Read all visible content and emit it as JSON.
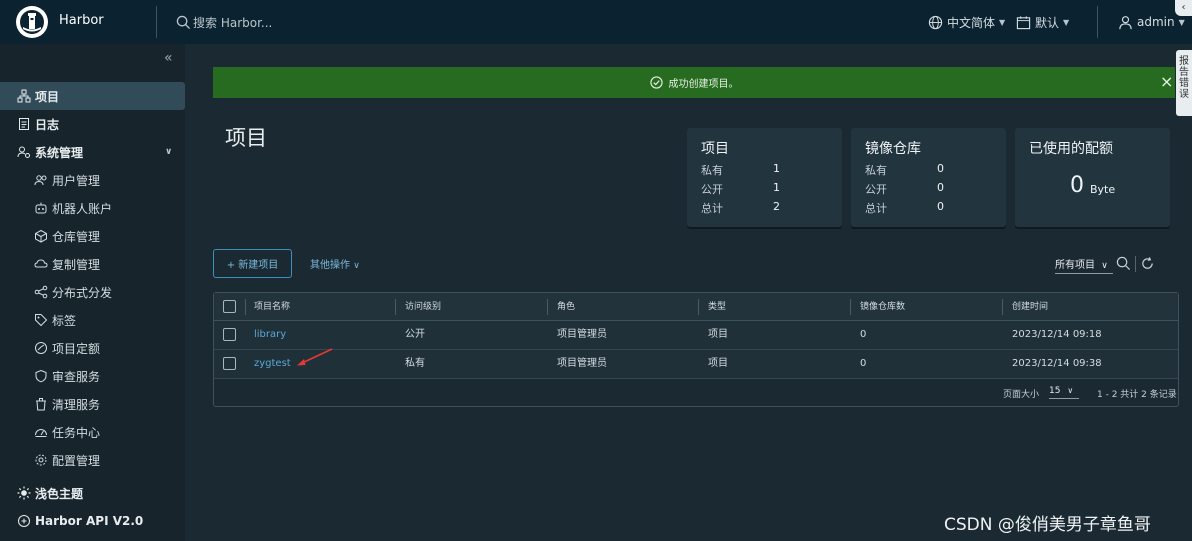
{
  "header": {
    "brand": "Harbor",
    "search_placeholder": "搜索 Harbor...",
    "language": "中文简体",
    "theme": "默认",
    "user": "admin",
    "corner_label": "‹"
  },
  "sidebar": {
    "collapse_label": "«",
    "items": [
      {
        "label": "项目",
        "icon": "projects-icon",
        "active": true
      },
      {
        "label": "日志",
        "icon": "logs-icon"
      },
      {
        "label": "系统管理",
        "icon": "admin-icon"
      },
      {
        "label": "用户管理",
        "icon": "users-icon"
      },
      {
        "label": "机器人账户",
        "icon": "robot-icon"
      },
      {
        "label": "仓库管理",
        "icon": "registry-icon"
      },
      {
        "label": "复制管理",
        "icon": "replication-icon"
      },
      {
        "label": "分布式分发",
        "icon": "distribution-icon"
      },
      {
        "label": "标签",
        "icon": "tag-icon"
      },
      {
        "label": "项目定额",
        "icon": "quota-icon"
      },
      {
        "label": "审查服务",
        "icon": "shield-icon"
      },
      {
        "label": "清理服务",
        "icon": "trash-icon"
      },
      {
        "label": "任务中心",
        "icon": "dashboard-icon"
      },
      {
        "label": "配置管理",
        "icon": "gear-icon"
      },
      {
        "label": "浅色主题",
        "icon": "sun-icon"
      },
      {
        "label": "Harbor API V2.0",
        "icon": "api-icon"
      }
    ]
  },
  "alert": {
    "message": "成功创建项目。",
    "close": "×"
  },
  "main": {
    "title": "项目",
    "cards": {
      "projects": {
        "title": "项目",
        "private_label": "私有",
        "private": "1",
        "public_label": "公开",
        "public": "1",
        "total_label": "总计",
        "total": "2"
      },
      "repos": {
        "title": "镜像仓库",
        "private_label": "私有",
        "private": "0",
        "public_label": "公开",
        "public": "0",
        "total_label": "总计",
        "total": "0"
      },
      "quota": {
        "title": "已使用的配额",
        "value": "0",
        "unit": "Byte"
      }
    },
    "new_project": "+ 新建项目",
    "more_actions": "其他操作",
    "filter": "所有项目"
  },
  "table": {
    "columns": [
      "项目名称",
      "访问级别",
      "角色",
      "类型",
      "镜像仓库数",
      "创建时间"
    ],
    "rows": [
      {
        "name": "library",
        "access": "公开",
        "role": "项目管理员",
        "type": "项目",
        "repos": "0",
        "created": "2023/12/14 09:18"
      },
      {
        "name": "zygtest",
        "access": "私有",
        "role": "项目管理员",
        "type": "项目",
        "repos": "0",
        "created": "2023/12/14 09:38"
      }
    ],
    "page_size_label": "页面大小",
    "page_size": "15",
    "summary": "1 - 2 共计 2 条记录"
  },
  "side_tab": "报告错误",
  "watermark": "CSDN @俊俏美男子章鱼哥",
  "colors": {
    "header": "#0b2330",
    "sidebar": "#17242b",
    "alert": "#266b20",
    "link": "#5aa8d6",
    "arrow": "#e53935"
  }
}
